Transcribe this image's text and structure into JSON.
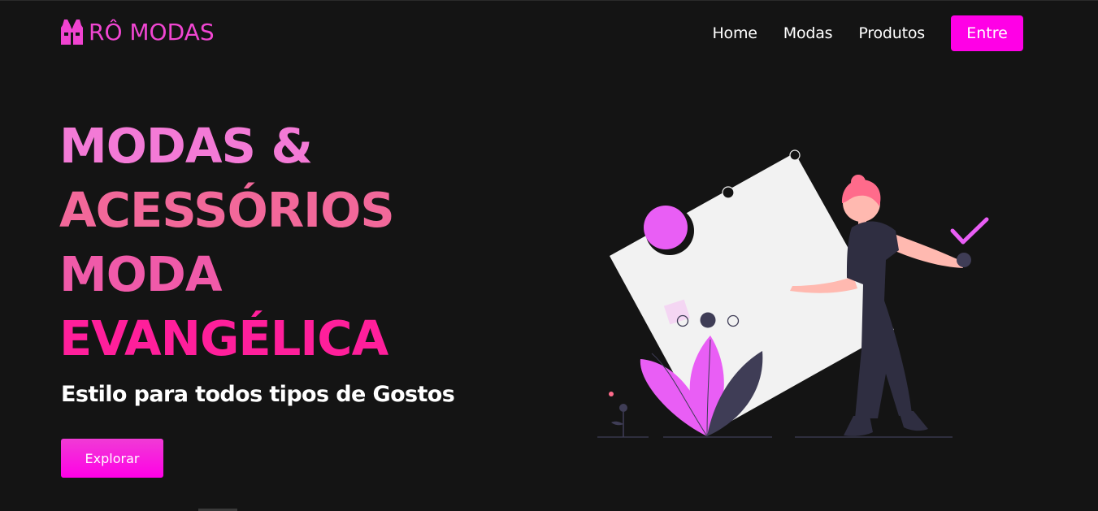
{
  "header": {
    "logo_text": "RÔ MODAS",
    "logo_icon": "vest-icon",
    "nav": [
      {
        "label": "Home"
      },
      {
        "label": "Modas"
      },
      {
        "label": "Produtos"
      }
    ],
    "cta_label": "Entre"
  },
  "hero": {
    "title_lines": [
      "MODAS &",
      "ACESSÓRIOS",
      "MODA",
      "EVANGÉLICA"
    ],
    "subtitle": "Estilo para todos tipos de Gostos",
    "button_label": "Explorar",
    "illustration": "woman-with-shapes-illustration"
  },
  "colors": {
    "background": "#141414",
    "accent": "#ff00e6",
    "title_pink": "#f37ad6",
    "title_rose": "#f2689a",
    "title_magenta": "#ff1f9b"
  }
}
